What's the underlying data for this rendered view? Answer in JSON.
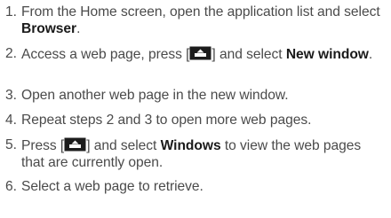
{
  "steps": [
    {
      "num": "1.",
      "pre": "From the Home screen, open the application list and select ",
      "kw": "Browser",
      "post": "."
    },
    {
      "num": "2.",
      "pre": "Access a web page, press [",
      "icon": "menu-key-icon",
      "mid": "] and select ",
      "kw": "New window",
      "post": "."
    },
    {
      "num": "3.",
      "text": "Open another web page in the new window."
    },
    {
      "num": "4.",
      "text": "Repeat steps 2 and 3 to open more web pages."
    },
    {
      "num": "5.",
      "pre": "Press [",
      "icon": "menu-key-icon",
      "mid": "] and select ",
      "kw": "Windows",
      "post": " to view the web pages that are currently open."
    },
    {
      "num": "6.",
      "text": "Select a web page to retrieve."
    }
  ]
}
